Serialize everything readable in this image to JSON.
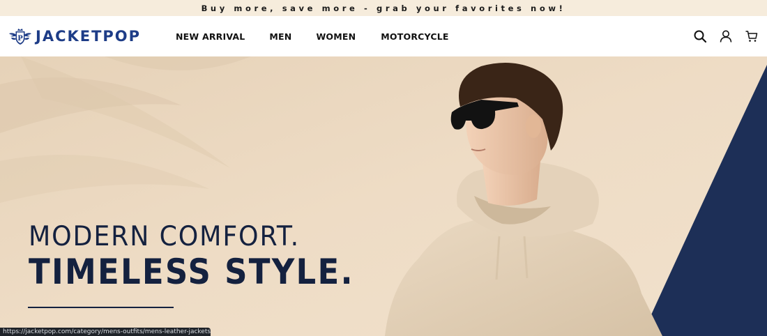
{
  "announcement": {
    "text": "Buy more, save more - grab your favorites now!"
  },
  "header": {
    "brand": "JACKETPOP",
    "nav": [
      {
        "label": "NEW ARRIVAL"
      },
      {
        "label": "MEN"
      },
      {
        "label": "WOMEN"
      },
      {
        "label": "MOTORCYCLE"
      }
    ],
    "icons": [
      "search-icon",
      "account-icon",
      "cart-icon"
    ]
  },
  "hero": {
    "line1": "MODERN COMFORT.",
    "line2": "TIMELESS STYLE."
  },
  "status_bar": {
    "url": "https://jacketpop.com/category/mens-outfits/mens-leather-jackets/"
  },
  "colors": {
    "announcement_bg": "#f6ecdc",
    "brand": "#1d3c87",
    "hero_bg": "#ecd9c1",
    "navy_panel": "#1d2f57",
    "headline": "#14213f",
    "hoodie": "#e5d4bd"
  }
}
